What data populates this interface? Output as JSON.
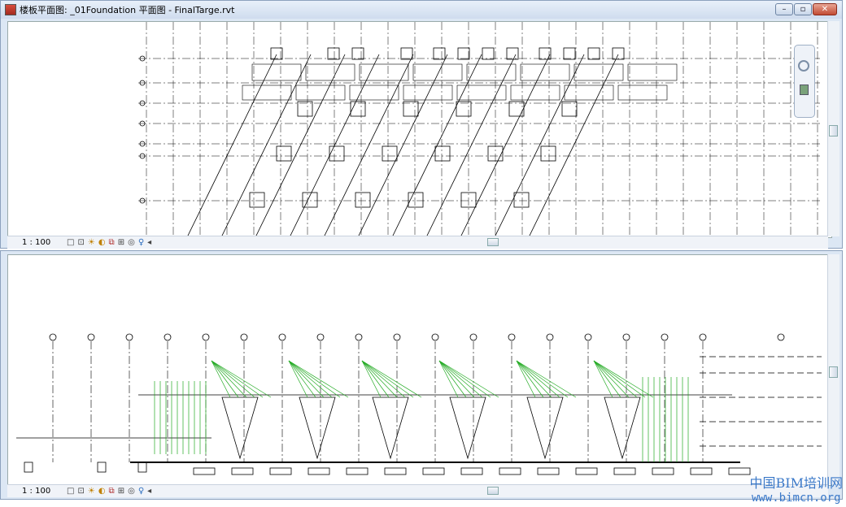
{
  "top_window": {
    "title": "楼板平面图: _01Foundation 平面图 - FinalTarge.rvt",
    "minimize_label": "–",
    "restore_label": "▫",
    "close_label": "✕",
    "scale": "1 : 100"
  },
  "bottom_window": {
    "scale": "1 : 100"
  },
  "watermark": {
    "line1": "中国BIM培训网",
    "line2": "www.bimcn.org"
  },
  "colors": {
    "drawing_line": "#000000",
    "section_lines": "#22aa22",
    "title_bar": "#cfdcee"
  }
}
